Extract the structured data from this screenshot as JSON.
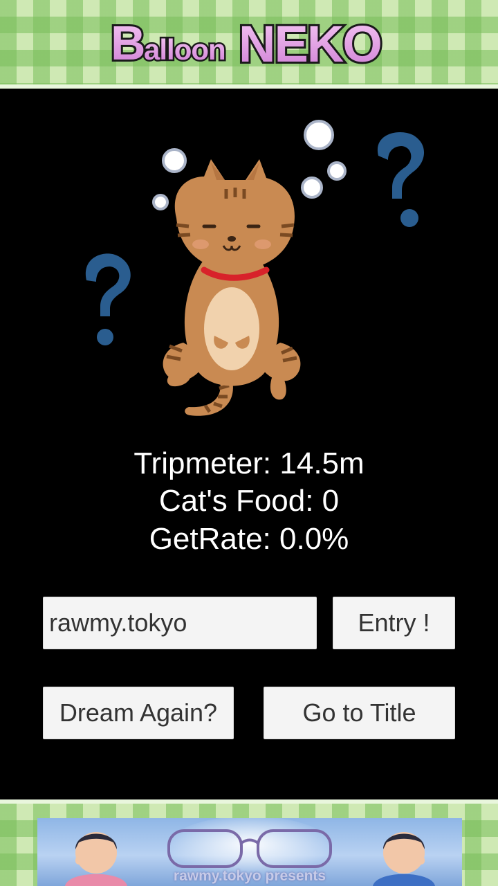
{
  "logo": {
    "prefix": "Balloon",
    "main": "NEKO"
  },
  "stats": {
    "tripmeter": "Tripmeter: 14.5m",
    "cats_food": "Cat's Food: 0",
    "get_rate": "GetRate: 0.0%"
  },
  "entry": {
    "name_value": "rawmy.tokyo",
    "button_label": "Entry !"
  },
  "actions": {
    "dream_again_label": "Dream Again?",
    "go_to_title_label": "Go to Title"
  },
  "ad": {
    "text": "rawmy.tokyo presents"
  },
  "icons": {
    "cat": "confused-cat-icon",
    "question_mark": "question-mark-icon"
  },
  "colors": {
    "background": "#000000",
    "logo_fill": "#e79ae9",
    "question_mark": "#2a5d8f",
    "cat_body": "#c98a52",
    "collar": "#d8222a"
  }
}
